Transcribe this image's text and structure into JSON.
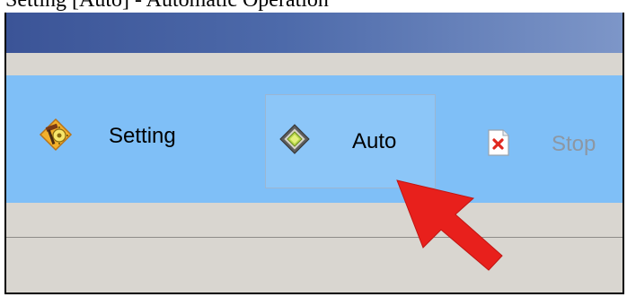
{
  "caption": {
    "text": "Setting [Auto] - Automatic Operation"
  },
  "toolbar": {
    "items": [
      {
        "label": "Setting",
        "icon": "hammer-gear-icon",
        "state": "normal"
      },
      {
        "label": "Auto",
        "icon": "chip-icon",
        "state": "highlighted"
      },
      {
        "label": "Stop",
        "icon": "stop-document-icon",
        "state": "disabled"
      }
    ]
  },
  "annotation": {
    "icon": "red-arrow-icon",
    "color": "#e8201c"
  },
  "colors": {
    "title_bar": "#4d6aaa",
    "toolbar": "#7fbff7",
    "panel": "#d9d6d0",
    "disabled_text": "#8d97a3"
  }
}
